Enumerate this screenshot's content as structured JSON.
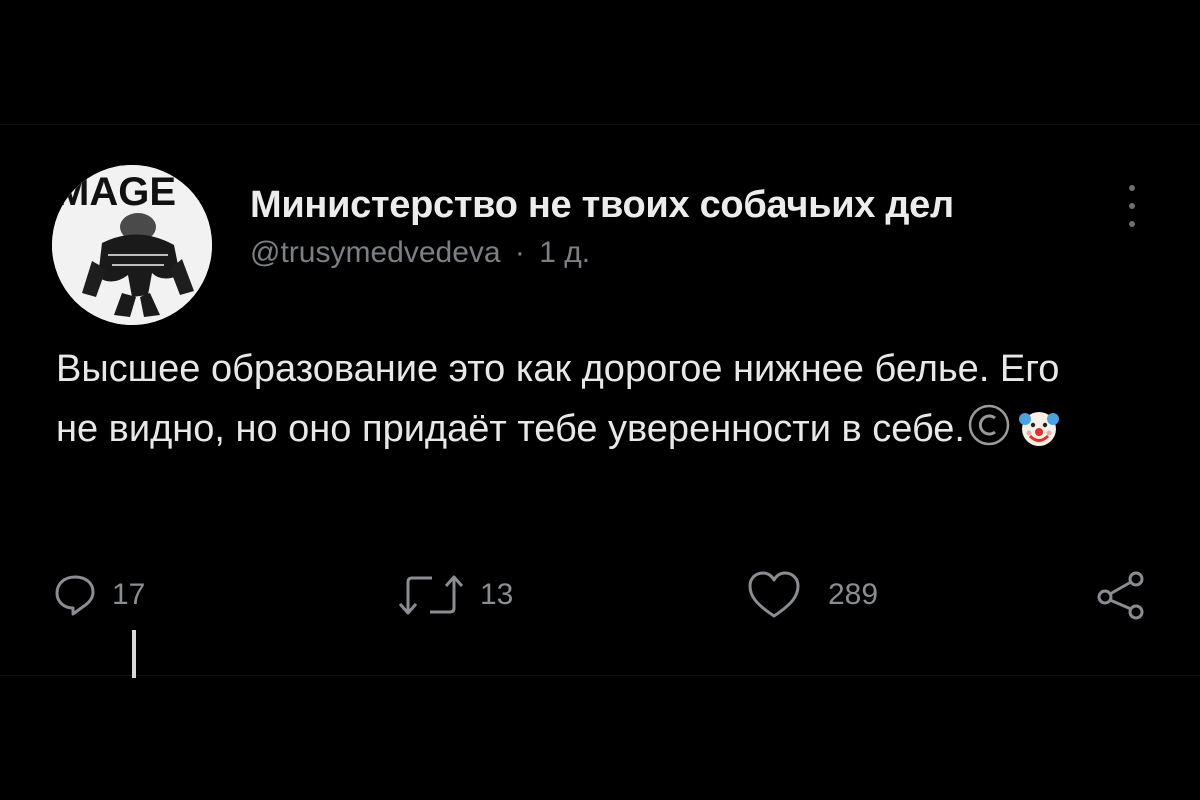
{
  "tweet": {
    "display_name": "Министерство не твоих собачьих дел",
    "handle": "@trusymedvedeva",
    "separator": "·",
    "time": "1 д.",
    "text": "Высшее образование это как дорогое нижнее бельe. Его не видно, но оно придаёт тебе уверенности в себе.",
    "avatar_caption": "MAGE"
  },
  "actions": {
    "reply_count": "17",
    "retweet_count": "13",
    "like_count": "289"
  },
  "colors": {
    "background": "#000000",
    "text": "#e8e8e8",
    "muted": "#7c7f84"
  }
}
